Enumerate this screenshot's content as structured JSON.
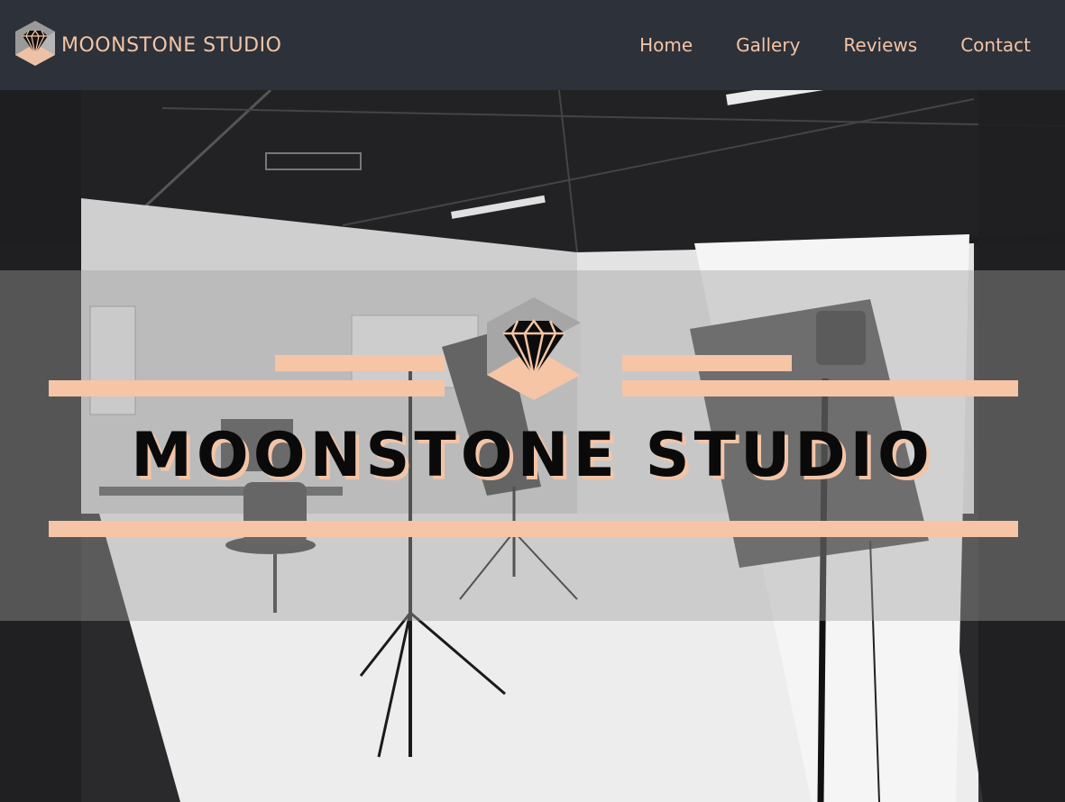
{
  "brand": {
    "name": "MOONSTONE STUDIO",
    "logo_icon": "gem-cube-icon"
  },
  "nav": {
    "items": [
      {
        "label": "Home"
      },
      {
        "label": "Gallery"
      },
      {
        "label": "Reviews"
      },
      {
        "label": "Contact"
      }
    ]
  },
  "hero": {
    "title": "MOONSTONE STUDIO",
    "logo_icon": "gem-cube-icon",
    "background": "photo-studio-grayscale"
  },
  "colors": {
    "navbar_bg": "#2d3139",
    "accent_peach": "#f6c5a6",
    "title_text": "#0a0a0a"
  }
}
